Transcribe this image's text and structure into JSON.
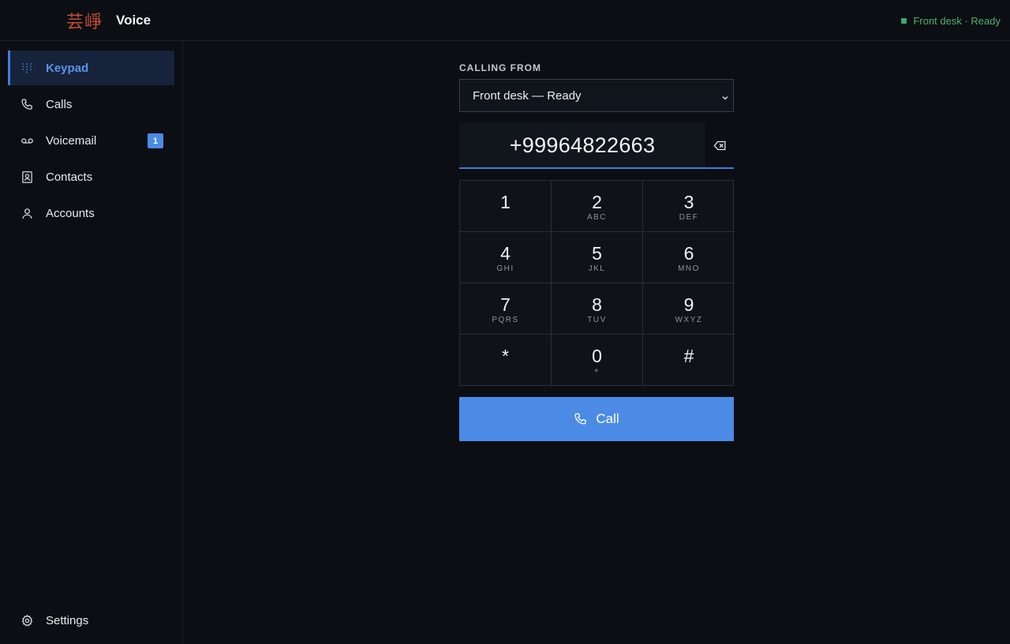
{
  "header": {
    "logo_text": "芸崢",
    "app_name": "Voice",
    "status": "Front desk · Ready",
    "status_color": "#3fa865"
  },
  "sidebar": {
    "items": [
      {
        "label": "Keypad",
        "icon": "keypad-icon",
        "active": true
      },
      {
        "label": "Calls",
        "icon": "phone-icon"
      },
      {
        "label": "Voicemail",
        "icon": "voicemail-icon",
        "badge": "1"
      },
      {
        "label": "Contacts",
        "icon": "contacts-icon"
      },
      {
        "label": "Accounts",
        "icon": "user-icon"
      }
    ],
    "settings_label": "Settings"
  },
  "dialer": {
    "calling_from_label": "CALLING FROM",
    "calling_from_value": "Front desk — Ready",
    "number": "+99964822663",
    "keys": [
      {
        "digit": "1",
        "letters": ""
      },
      {
        "digit": "2",
        "letters": "ABC"
      },
      {
        "digit": "3",
        "letters": "DEF"
      },
      {
        "digit": "4",
        "letters": "GHI"
      },
      {
        "digit": "5",
        "letters": "JKL"
      },
      {
        "digit": "6",
        "letters": "MNO"
      },
      {
        "digit": "7",
        "letters": "PQRS"
      },
      {
        "digit": "8",
        "letters": "TUV"
      },
      {
        "digit": "9",
        "letters": "WXYZ"
      },
      {
        "digit": "*",
        "letters": ""
      },
      {
        "digit": "0",
        "letters": "+"
      },
      {
        "digit": "#",
        "letters": ""
      }
    ],
    "call_label": "Call",
    "accent_color": "#4b8be6"
  }
}
